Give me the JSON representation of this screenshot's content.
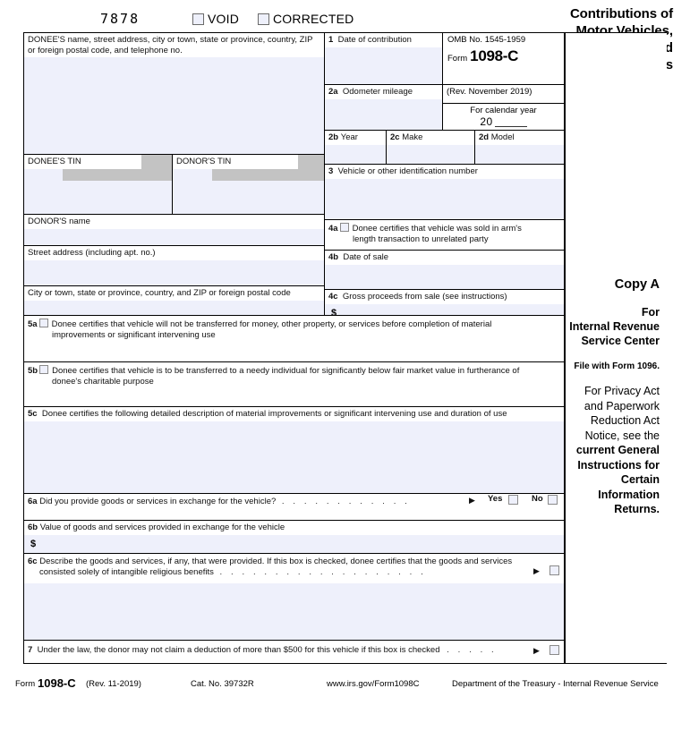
{
  "top": {
    "ocr_number": "7878",
    "void_label": "VOID",
    "corrected_label": "CORRECTED"
  },
  "title": {
    "line1": "Contributions of",
    "line2": "Motor Vehicles,",
    "line3": "Boats, and",
    "line4": "Airplanes"
  },
  "boxes": {
    "donee_address": "DONEE'S name, street address, city or town, state or province, country, ZIP or foreign postal code, and telephone no.",
    "box1_label_num": "1",
    "box1_label": "Date of contribution",
    "omb": "OMB No. 1545-1959",
    "form_word": "Form",
    "form_number": "1098-C",
    "rev": "(Rev. November 2019)",
    "box2a_num": "2a",
    "box2a_label": "Odometer mileage",
    "calendar_caption": "For calendar year",
    "calendar_year_prefix": "20",
    "box2b_num": "2b",
    "box2b_label": "Year",
    "box2c_num": "2c",
    "box2c_label": "Make",
    "box2d_num": "2d",
    "box2d_label": "Model",
    "donee_tin": "DONEE'S TIN",
    "donor_tin": "DONOR'S TIN",
    "box3_num": "3",
    "box3_label": "Vehicle or other identification number",
    "donor_name": "DONOR'S name",
    "box4a_num": "4a",
    "box4a_line1": "Donee certifies that vehicle was sold in arm's",
    "box4a_line2": "length transaction to unrelated party",
    "street_address": "Street address (including apt. no.)",
    "box4b_num": "4b",
    "box4b_label": "Date of sale",
    "city_state": "City or town, state or province, country, and ZIP or foreign postal code",
    "box4c_num": "4c",
    "box4c_label": "Gross proceeds from sale (see instructions)",
    "dollar_sign": "$",
    "box5a_num": "5a",
    "box5a_line1": "Donee certifies that vehicle will not be transferred for money, other property, or services before completion of material",
    "box5a_line2": "improvements or significant intervening use",
    "box5b_num": "5b",
    "box5b_line1": "Donee certifies that vehicle is to be transferred to a needy individual for significantly below fair market value in furtherance of",
    "box5b_line2": "donee's charitable purpose",
    "box5c_num": "5c",
    "box5c_label": "Donee certifies the following detailed description of material improvements or significant intervening use and duration of use",
    "box6a_num": "6a",
    "box6a_label": "Did you provide goods or services in exchange for the vehicle?",
    "yes_label": "Yes",
    "no_label": "No",
    "box6b_num": "6b",
    "box6b_label": "Value of goods and services provided in exchange for the vehicle",
    "box6c_num": "6c",
    "box6c_line1": "Describe the goods and services, if any, that were provided. If this box is checked, donee certifies that the goods and services",
    "box6c_line2": "consisted solely of intangible religious benefits",
    "box7_num": "7",
    "box7_label": "Under the law, the donor may not claim a deduction of more than $500 for this vehicle if this box is checked",
    "dots": ". . . . . . . . . . . .",
    "dots_short": ". . . . .",
    "dots_long": ". . . . . . . . . . . . . . . . . . ."
  },
  "copy": {
    "copy_a": "Copy A",
    "for": "For",
    "irs_line1": "Internal Revenue",
    "irs_line2": "Service Center",
    "file_with": "File with Form 1096.",
    "privacy_line1": "For Privacy Act",
    "privacy_line2": "and Paperwork",
    "privacy_line3": "Reduction Act",
    "privacy_line4": "Notice, see the",
    "privacy_line5": "current General",
    "privacy_line6": "Instructions for",
    "privacy_line7": "Certain",
    "privacy_line8": "Information",
    "privacy_line9": "Returns."
  },
  "footer": {
    "form_word": "Form",
    "form_number": "1098-C",
    "rev": "(Rev. 11-2019)",
    "cat": "Cat. No. 39732R",
    "url": "www.irs.gov/Form1098C",
    "dept": "Department of the Treasury - Internal Revenue Service"
  },
  "colors": {
    "field_fill": "#eef0fb",
    "redaction": "#c3c3c3",
    "border": "#000000"
  }
}
